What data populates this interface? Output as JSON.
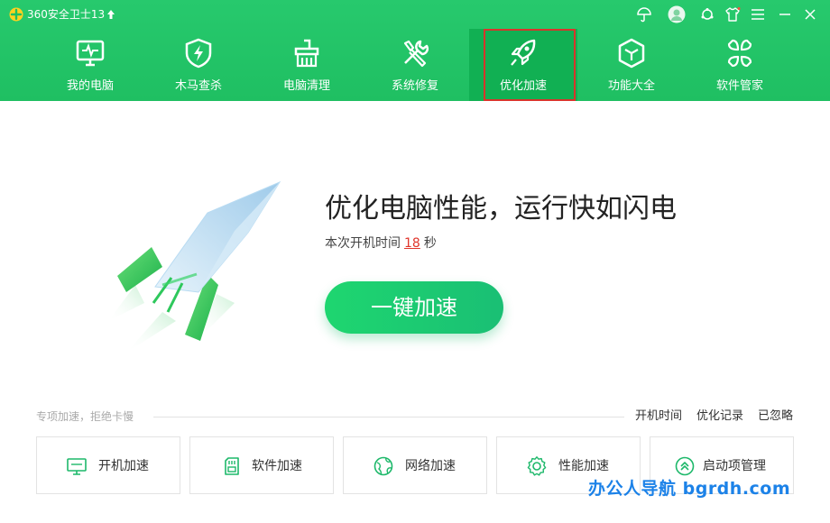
{
  "app": {
    "title": "360安全卫士13"
  },
  "nav": {
    "items": [
      {
        "label": "我的电脑",
        "icon": "monitor-icon"
      },
      {
        "label": "木马查杀",
        "icon": "shield-bolt-icon"
      },
      {
        "label": "电脑清理",
        "icon": "broom-icon"
      },
      {
        "label": "系统修复",
        "icon": "wrench-screwdriver-icon"
      },
      {
        "label": "优化加速",
        "icon": "rocket-icon",
        "active": true
      },
      {
        "label": "功能大全",
        "icon": "cube-icon"
      },
      {
        "label": "软件管家",
        "icon": "app-grid-icon"
      }
    ]
  },
  "window_controls": [
    "umbrella-icon",
    "avatar",
    "skin-icon",
    "shirt-icon",
    "menu-icon",
    "minimize-icon",
    "close-icon"
  ],
  "hero": {
    "title": "优化电脑性能，运行快如闪电",
    "boot_prefix": "本次开机时间",
    "boot_seconds": "18",
    "boot_unit": "秒",
    "button_label": "一键加速"
  },
  "section": {
    "label": "专项加速，拒绝卡慢",
    "links": [
      "开机时间",
      "优化记录",
      "已忽略"
    ]
  },
  "cards": [
    {
      "label": "开机加速",
      "icon": "monitor-icon"
    },
    {
      "label": "软件加速",
      "icon": "sd-card-icon"
    },
    {
      "label": "网络加速",
      "icon": "globe-icon"
    },
    {
      "label": "性能加速",
      "icon": "gear-icon"
    },
    {
      "label": "启动项管理",
      "icon": "chevron-up-circle-icon"
    }
  ],
  "watermark": "办公人导航 bgrdh.com",
  "colors": {
    "header_green": "#1fbf62",
    "active_tab": "#11b053",
    "highlight_red": "#d9342b",
    "accent_red": "#e0352b",
    "button_green": "#1ed670"
  }
}
